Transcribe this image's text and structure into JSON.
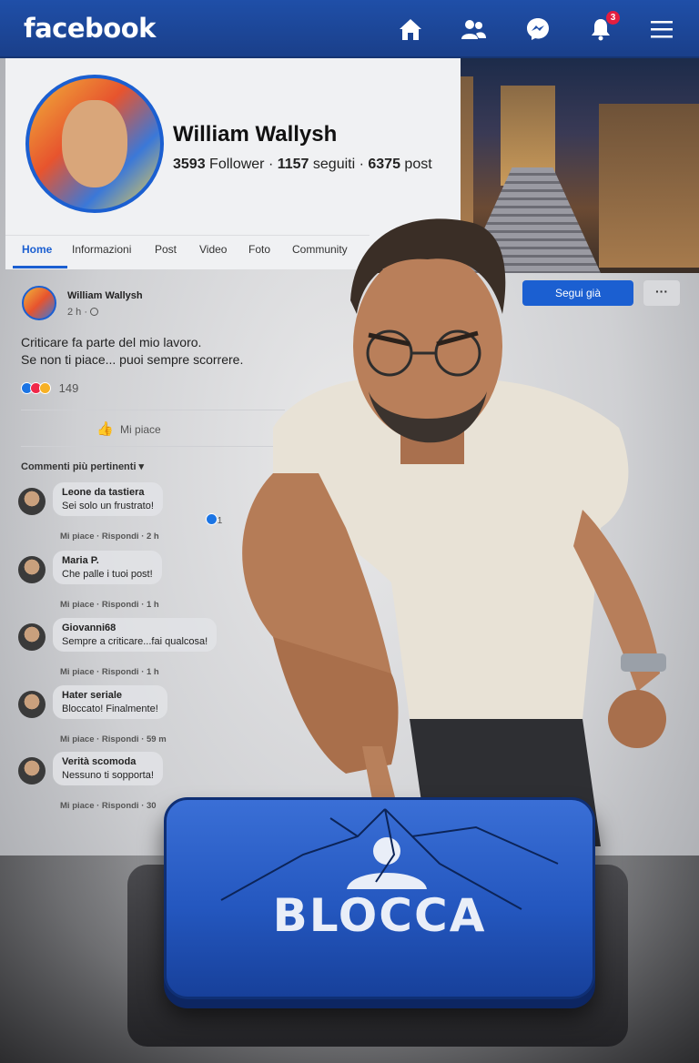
{
  "navbar": {
    "logo": "facebook",
    "notifications_count": "3",
    "icons": [
      "home-icon",
      "friends-icon",
      "messenger-icon",
      "bell-icon",
      "menu-icon"
    ]
  },
  "profile": {
    "name": "William Wallysh",
    "followers": "3593",
    "followers_label": "Follower",
    "following": "1157",
    "following_label": "seguiti",
    "posts": "6375",
    "posts_label": "post",
    "separator": " · "
  },
  "tabs": [
    {
      "label": "Home"
    },
    {
      "label": "Informazioni"
    },
    {
      "label": "Post"
    },
    {
      "label": "Video"
    },
    {
      "label": "Foto"
    },
    {
      "label": "Community"
    }
  ],
  "actions": {
    "follow_label": "Segui già",
    "more_label": "···"
  },
  "post": {
    "author": "William Wallysh",
    "time": "2 h · ",
    "text_line1": "Criticare fa parte del mio lavoro.",
    "text_line2": "Se non ti piace... puoi sempre scorrere.",
    "reaction_count": "149",
    "like_label": "Mi piace",
    "comments_header": "Commenti più pertinenti ▾"
  },
  "comments": [
    {
      "name": "Leone da tastiera",
      "text": "Sei solo un frustrato!",
      "meta": "Mi piace · Rispondi · 2 h",
      "likes": "1"
    },
    {
      "name": "Maria P.",
      "text": "Che palle i tuoi post!",
      "meta": "Mi piace · Rispondi · 1 h"
    },
    {
      "name": "Giovanni68",
      "text": "Sempre a criticare...fai qualcosa!",
      "meta": "Mi piace · Rispondi · 1 h"
    },
    {
      "name": "Hater seriale",
      "text": "Bloccato! Finalmente!",
      "meta": "Mi piace · Rispondi · 59 m"
    },
    {
      "name": "Verità scomoda",
      "text": "Nessuno ti sopporta!",
      "meta": "Mi piace · Rispondi · 30"
    }
  ],
  "block_button": {
    "label": "BLOCCA"
  },
  "colors": {
    "brand_blue": "#1b5fd1",
    "navbar_blue": "#1f4fa8",
    "block_blue": "#2457bf"
  }
}
